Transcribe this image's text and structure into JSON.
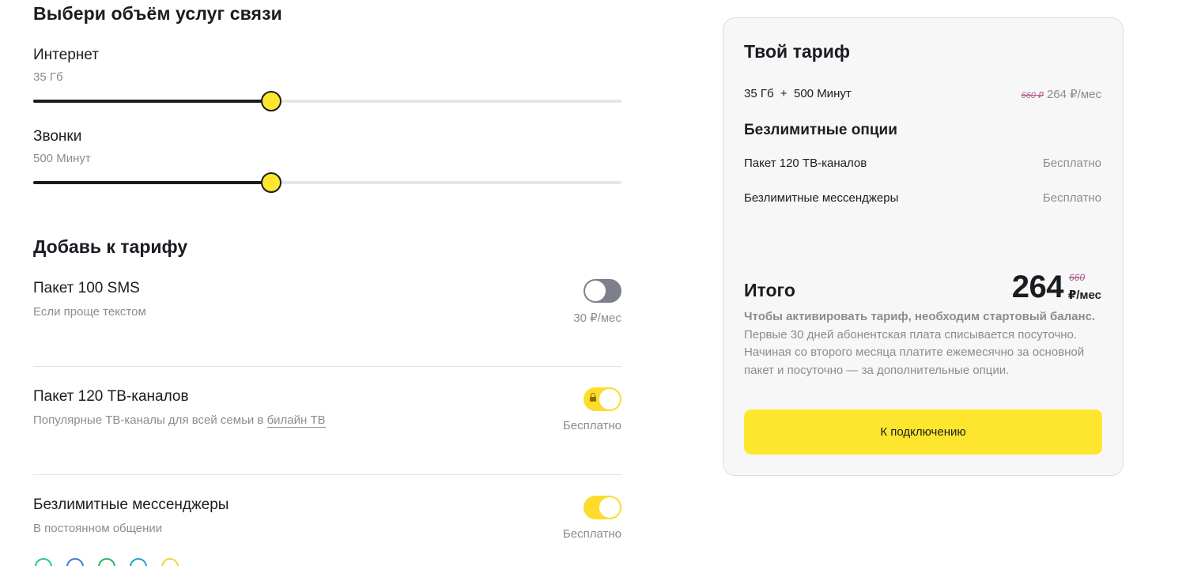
{
  "configurator": {
    "heading": "Выбери объём услуг связи",
    "internet": {
      "label": "Интернет",
      "value": "35 Гб",
      "level": 0.404
    },
    "calls": {
      "label": "Звонки",
      "value": "500 Минут",
      "level": 0.404
    }
  },
  "addons": {
    "heading": "Добавь к тарифу",
    "items": [
      {
        "title": "Пакет 100 SMS",
        "desc": "Если проще текстом",
        "price": "30 ₽/мес",
        "enabled": false,
        "locked": false
      },
      {
        "title": "Пакет 120 ТВ-каналов",
        "desc_prefix": "Популярные ТВ-каналы для всей семьи в ",
        "desc_link": "билайн ТВ",
        "price": "Бесплатно",
        "enabled": true,
        "locked": true
      },
      {
        "title": "Безлимитные мессенджеры",
        "desc": "В постоянном общении",
        "price": "Бесплатно",
        "enabled": true,
        "locked": false
      }
    ]
  },
  "summary": {
    "title": "Твой тариф",
    "plan": "35 Гб  +  500 Минут",
    "plan_old_price": "660 ₽",
    "plan_price": "264 ₽/мес",
    "options_title": "Безлимитные опции",
    "options": [
      {
        "name": "Пакет 120 ТВ-каналов",
        "price": "Бесплатно"
      },
      {
        "name": "Безлимитные мессенджеры",
        "price": "Бесплатно"
      }
    ],
    "total_label": "Итого",
    "total_amount": "264",
    "total_old": "660",
    "total_unit": "₽/мес",
    "note_bold": "Чтобы активировать тариф, необходим стартовый баланс.",
    "note_text": " Первые 30 дней абонентская плата списывается посуточно. Начиная со второго месяца платите ежемесячно за основной пакет и посуточно — за дополнительные опции.",
    "cta": "К подключению"
  },
  "colors": {
    "accent": "#ffe62e",
    "text": "#191c21",
    "muted": "#8a8c91",
    "toggle_off": "#7d7f8d",
    "toggle_on": "#fddc2b",
    "old_price": "#b05a8c"
  }
}
